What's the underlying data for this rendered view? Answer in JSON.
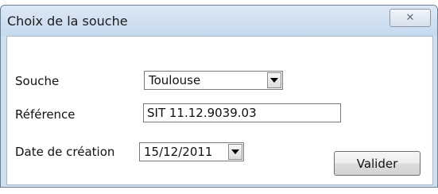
{
  "window": {
    "title": "Choix de la souche",
    "close_glyph": "✕"
  },
  "form": {
    "souche": {
      "label": "Souche",
      "value": "Toulouse"
    },
    "reference": {
      "label": "Référence",
      "value": "SIT 11.12.9039.03"
    },
    "date": {
      "label": "Date de création",
      "value": "15/12/2011"
    }
  },
  "actions": {
    "validate_label": "Valider"
  },
  "icons": {
    "close": "close-icon",
    "dropdown": "chevron-down-icon"
  }
}
